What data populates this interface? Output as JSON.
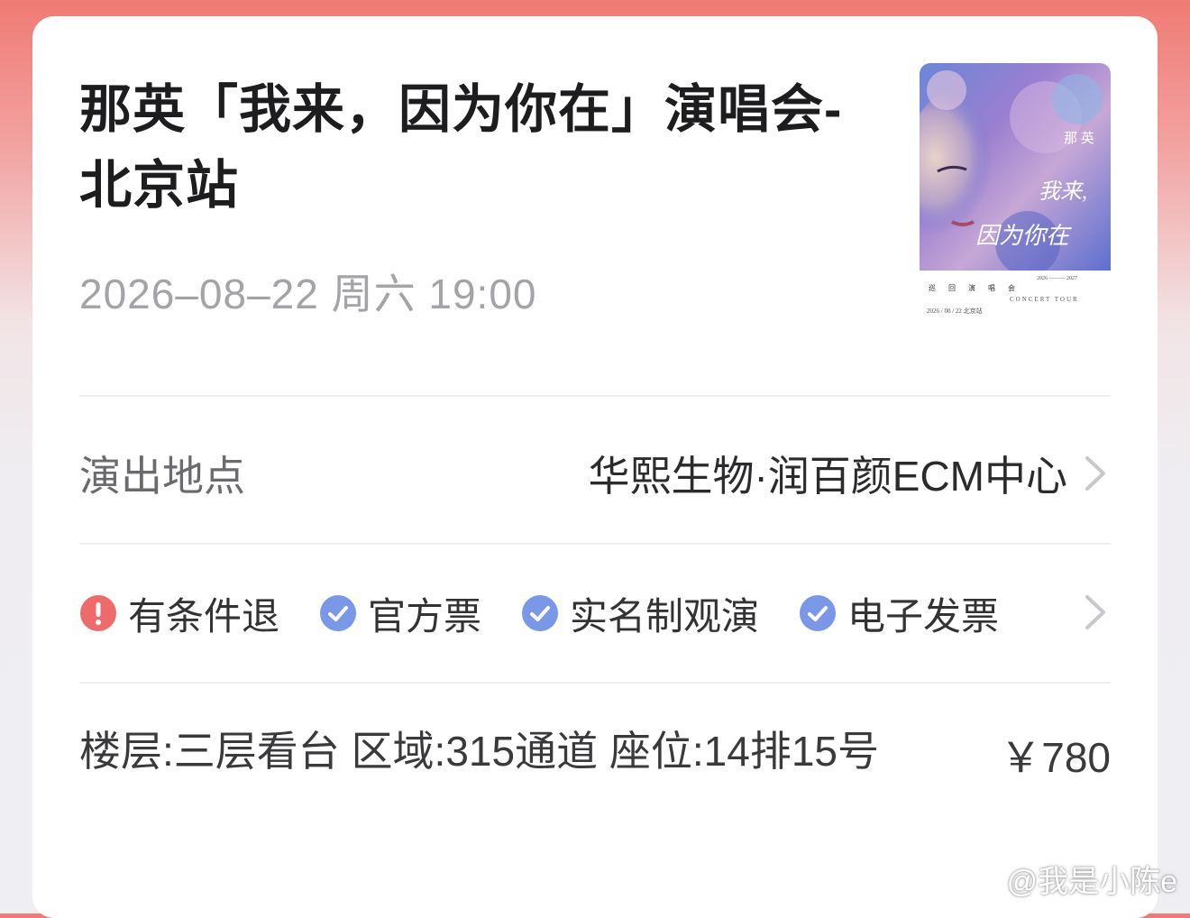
{
  "event": {
    "title": "那英「我来，因为你在」演唱会-北京站",
    "datetime": "2026–08–22 周六 19:00"
  },
  "poster": {
    "artist": "那 英",
    "title_line1": "我来,",
    "title_line2": "因为你在",
    "tour_label": "巡 回 演 唱 会",
    "tour_en": "CONCERT TOUR",
    "years": "2026 ——— 2027",
    "footer": "2026 / 08 / 22  北京站"
  },
  "venue": {
    "label": "演出地点",
    "value": "华熙生物·润百颜ECM中心"
  },
  "tags": [
    {
      "label": "有条件退",
      "icon": "exclamation-icon",
      "color": "#ef6a6a"
    },
    {
      "label": "官方票",
      "icon": "check-icon",
      "color": "#7b97e8"
    },
    {
      "label": "实名制观演",
      "icon": "check-icon",
      "color": "#7b97e8"
    },
    {
      "label": "电子发票",
      "icon": "check-icon",
      "color": "#7b97e8"
    }
  ],
  "seat": {
    "text": "楼层:三层看台  区域:315通道  座位:14排15号",
    "price": "￥780"
  },
  "watermark": "@我是小陈e",
  "colors": {
    "header_gradient": "#f07a74",
    "warning": "#ef6a6a",
    "check": "#7b97e8",
    "muted_text": "#a3a3a8"
  }
}
